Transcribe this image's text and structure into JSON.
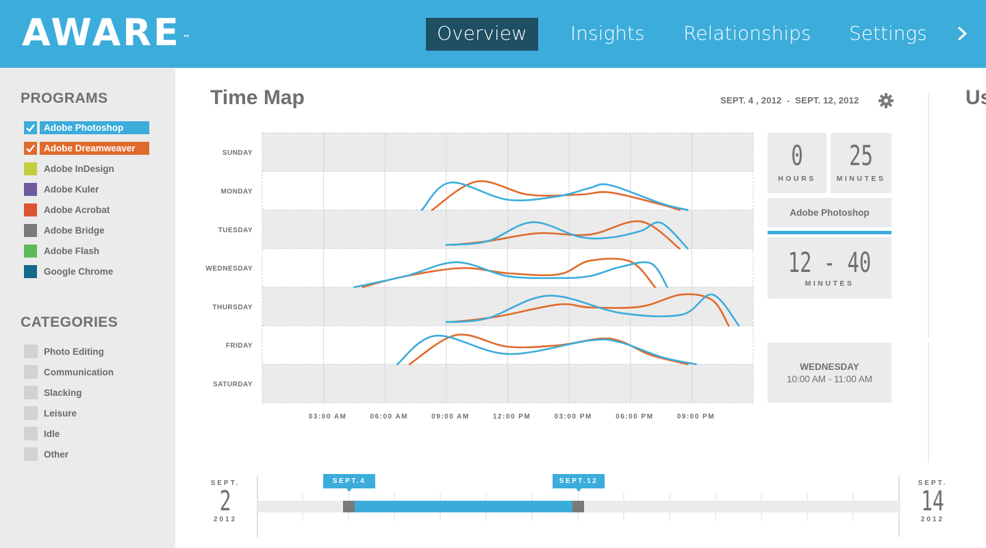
{
  "header": {
    "logo": "AWARE",
    "logo_tm": "™",
    "nav": [
      {
        "label": "Overview",
        "active": true
      },
      {
        "label": "Insights",
        "active": false
      },
      {
        "label": "Relationships",
        "active": false
      },
      {
        "label": "Settings",
        "active": false
      }
    ],
    "nav_more_icon": "chevron-right-icon"
  },
  "sidebar": {
    "programs_heading": "PROGRAMS",
    "programs": [
      {
        "label": "Adobe Photoshop",
        "color": "#3cacdb",
        "checked": true
      },
      {
        "label": "Adobe Dreamweaver",
        "color": "#e06a2c",
        "checked": true
      },
      {
        "label": "Adobe InDesign",
        "color": "#c2cf3d",
        "checked": false
      },
      {
        "label": "Adobe Kuler",
        "color": "#6e5a9e",
        "checked": false
      },
      {
        "label": "Adobe Acrobat",
        "color": "#db5530",
        "checked": false
      },
      {
        "label": "Adobe Bridge",
        "color": "#7a7a7a",
        "checked": false
      },
      {
        "label": "Adobe Flash",
        "color": "#5cba5a",
        "checked": false
      },
      {
        "label": "Google Chrome",
        "color": "#16688a",
        "checked": false
      }
    ],
    "categories_heading": "CATEGORIES",
    "categories": [
      "Photo Editing",
      "Communication",
      "Slacking",
      "Leisure",
      "Idle",
      "Other"
    ]
  },
  "main": {
    "title": "Time Map",
    "date_range": "SEPT. 4 , 2012  -  SEPT. 12, 2012",
    "settings_icon": "gear-icon"
  },
  "chart_data": {
    "type": "line",
    "days": [
      "SUNDAY",
      "MONDAY",
      "TUESDAY",
      "WEDNESDAY",
      "THURSDAY",
      "FRIDAY",
      "SATURDAY"
    ],
    "x_tick_labels": [
      "03:00 AM",
      "06:00 AM",
      "09:00 AM",
      "12:00 PM",
      "03:00 PM",
      "06:00 PM",
      "09:00 PM"
    ],
    "x_unit": "hour of day",
    "xlim": [
      0,
      24
    ],
    "grid": true,
    "series": [
      {
        "name": "Adobe Photoshop",
        "color": "#3cacdb",
        "rows": {
          "MONDAY": [
            [
              7.8,
              0.0
            ],
            [
              9.2,
              0.75
            ],
            [
              12.0,
              0.28
            ],
            [
              14.5,
              0.38
            ],
            [
              16.0,
              0.6
            ],
            [
              17.0,
              0.68
            ],
            [
              19.5,
              0.18
            ],
            [
              20.8,
              0.0
            ]
          ],
          "TUESDAY": [
            [
              9.0,
              0.1
            ],
            [
              11.0,
              0.2
            ],
            [
              13.2,
              0.72
            ],
            [
              15.5,
              0.32
            ],
            [
              17.0,
              0.3
            ],
            [
              18.5,
              0.48
            ],
            [
              19.5,
              0.7
            ],
            [
              20.8,
              0.0
            ]
          ],
          "WEDNESDAY": [
            [
              4.5,
              0.0
            ],
            [
              7.0,
              0.3
            ],
            [
              9.5,
              0.68
            ],
            [
              12.0,
              0.3
            ],
            [
              14.5,
              0.25
            ],
            [
              16.0,
              0.3
            ],
            [
              17.5,
              0.55
            ],
            [
              19.0,
              0.65
            ],
            [
              19.8,
              0.0
            ]
          ],
          "THURSDAY": [
            [
              9.0,
              0.1
            ],
            [
              11.0,
              0.2
            ],
            [
              14.0,
              0.82
            ],
            [
              17.5,
              0.35
            ],
            [
              20.5,
              0.3
            ],
            [
              22.0,
              0.85
            ],
            [
              23.3,
              0.0
            ]
          ],
          "FRIDAY": [
            [
              6.6,
              0.0
            ],
            [
              8.5,
              0.78
            ],
            [
              12.0,
              0.28
            ],
            [
              16.0,
              0.65
            ],
            [
              17.5,
              0.6
            ],
            [
              19.5,
              0.2
            ],
            [
              21.2,
              0.0
            ]
          ]
        }
      },
      {
        "name": "Adobe Dreamweaver",
        "color": "#e06a2c",
        "rows": {
          "MONDAY": [
            [
              8.3,
              0.0
            ],
            [
              10.5,
              0.78
            ],
            [
              13.0,
              0.42
            ],
            [
              15.5,
              0.42
            ],
            [
              17.0,
              0.48
            ],
            [
              19.5,
              0.15
            ],
            [
              20.4,
              0.0
            ]
          ],
          "TUESDAY": [
            [
              9.3,
              0.1
            ],
            [
              11.0,
              0.2
            ],
            [
              13.5,
              0.42
            ],
            [
              16.0,
              0.38
            ],
            [
              18.5,
              0.74
            ],
            [
              20.4,
              0.0
            ]
          ],
          "WEDNESDAY": [
            [
              4.9,
              0.0
            ],
            [
              7.0,
              0.3
            ],
            [
              9.8,
              0.52
            ],
            [
              12.0,
              0.38
            ],
            [
              14.5,
              0.35
            ],
            [
              16.0,
              0.72
            ],
            [
              18.0,
              0.7
            ],
            [
              19.2,
              0.0
            ]
          ],
          "THURSDAY": [
            [
              9.3,
              0.1
            ],
            [
              11.5,
              0.25
            ],
            [
              14.5,
              0.58
            ],
            [
              16.0,
              0.5
            ],
            [
              18.5,
              0.52
            ],
            [
              20.5,
              0.85
            ],
            [
              22.0,
              0.7
            ],
            [
              22.8,
              0.0
            ]
          ],
          "FRIDAY": [
            [
              7.2,
              0.0
            ],
            [
              9.5,
              0.8
            ],
            [
              12.0,
              0.48
            ],
            [
              14.5,
              0.52
            ],
            [
              17.0,
              0.7
            ],
            [
              19.0,
              0.25
            ],
            [
              20.8,
              0.0
            ]
          ]
        }
      }
    ]
  },
  "stats": {
    "hours_value": "0",
    "hours_label": "HOURS",
    "minutes_value": "25",
    "minutes_label": "MINUTES",
    "program": "Adobe Photoshop",
    "range_value": "12 - 40",
    "range_label": "MINUTES",
    "day": "WEDNESDAY",
    "time": "10:00 AM - 11:00 AM"
  },
  "right_panel": {
    "title": "Us"
  },
  "timeline": {
    "start_month": "SEPT.",
    "start_day": "2",
    "start_year": "2012",
    "end_month": "SEPT.",
    "end_day": "14",
    "end_year": "2012",
    "from_flag": "SEPT.4",
    "to_flag": "SEPT.12",
    "selection_color": "#3cacdb"
  }
}
